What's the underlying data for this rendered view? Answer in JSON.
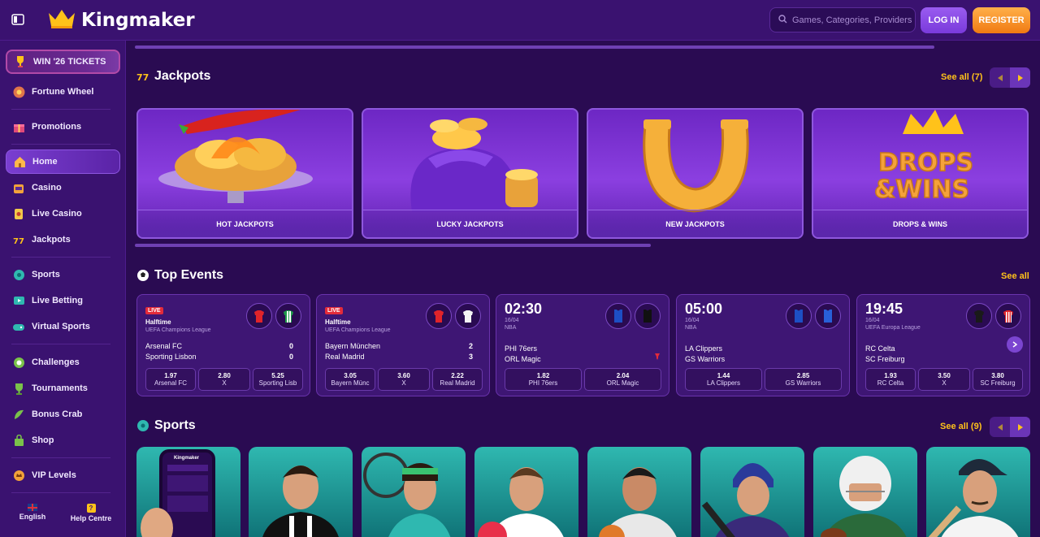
{
  "brand": {
    "name": "Kingmaker"
  },
  "header": {
    "search_placeholder": "Games, Categories, Providers",
    "login_label": "LOG IN",
    "register_label": "REGISTER"
  },
  "sidebar": {
    "items": [
      {
        "label": "WIN '26 TICKETS",
        "icon": "trophy-icon"
      },
      {
        "label": "Fortune Wheel",
        "icon": "wheel-icon"
      },
      {
        "label": "Promotions",
        "icon": "gift-icon"
      },
      {
        "label": "Home",
        "icon": "home-icon"
      },
      {
        "label": "Casino",
        "icon": "slot-icon"
      },
      {
        "label": "Live Casino",
        "icon": "card-icon"
      },
      {
        "label": "Jackpots",
        "icon": "777-icon"
      },
      {
        "label": "Sports",
        "icon": "ball-icon"
      },
      {
        "label": "Live Betting",
        "icon": "live-icon"
      },
      {
        "label": "Virtual Sports",
        "icon": "gamepad-icon"
      },
      {
        "label": "Challenges",
        "icon": "target-icon"
      },
      {
        "label": "Tournaments",
        "icon": "cup-icon"
      },
      {
        "label": "Bonus Crab",
        "icon": "crab-icon"
      },
      {
        "label": "Shop",
        "icon": "bag-icon"
      },
      {
        "label": "VIP Levels",
        "icon": "crown-coin-icon"
      }
    ],
    "footer": {
      "language": "English",
      "help": "Help Centre"
    }
  },
  "jackpots": {
    "title": "Jackpots",
    "see_all": "See all (7)",
    "cards": [
      "HOT JACKPOTS",
      "LUCKY JACKPOTS",
      "NEW JACKPOTS",
      "DROPS & WINS"
    ],
    "drops_logo_text": "DROPS & WINS"
  },
  "top_events": {
    "title": "Top Events",
    "see_all": "See all",
    "events": [
      {
        "live": "LIVE",
        "status": "Halftime",
        "league": "UEFA Champions League",
        "home": "Arsenal FC",
        "away": "Sporting Lisbon",
        "home_score": "0",
        "away_score": "0",
        "odds": [
          {
            "price": "1.97",
            "label": "Arsenal FC"
          },
          {
            "price": "2.80",
            "label": "X"
          },
          {
            "price": "5.25",
            "label": "Sporting Lisb"
          }
        ]
      },
      {
        "live": "LIVE",
        "status": "Halftime",
        "league": "UEFA Champions League",
        "home": "Bayern München",
        "away": "Real Madrid",
        "home_score": "2",
        "away_score": "3",
        "odds": [
          {
            "price": "3.05",
            "label": "Bayern Münc"
          },
          {
            "price": "3.60",
            "label": "X"
          },
          {
            "price": "2.22",
            "label": "Real Madrid"
          }
        ]
      },
      {
        "time": "02:30",
        "date": "16/04",
        "league": "NBA",
        "home": "PHI 76ers",
        "away": "ORL Magic",
        "odds": [
          {
            "price": "1.82",
            "label": "PHI 76ers"
          },
          {
            "price": "2.04",
            "label": "ORL Magic"
          }
        ]
      },
      {
        "time": "05:00",
        "date": "16/04",
        "league": "NBA",
        "home": "LA Clippers",
        "away": "GS Warriors",
        "odds": [
          {
            "price": "1.44",
            "label": "LA Clippers"
          },
          {
            "price": "2.85",
            "label": "GS Warriors"
          }
        ]
      },
      {
        "time": "19:45",
        "date": "16/04",
        "league": "UEFA Europa League",
        "home": "RC Celta",
        "away": "SC Freiburg",
        "odds": [
          {
            "price": "1.93",
            "label": "RC Celta"
          },
          {
            "price": "3.50",
            "label": "X"
          },
          {
            "price": "3.80",
            "label": "SC Freiburg"
          }
        ]
      }
    ]
  },
  "sports": {
    "title": "Sports",
    "see_all": "See all (9)",
    "mini_logo": "Kingmaker"
  },
  "colors": {
    "accent": "#ffc21a",
    "bg": "#2a0b52",
    "panel": "#3a1270",
    "live": "#e32b3a"
  }
}
